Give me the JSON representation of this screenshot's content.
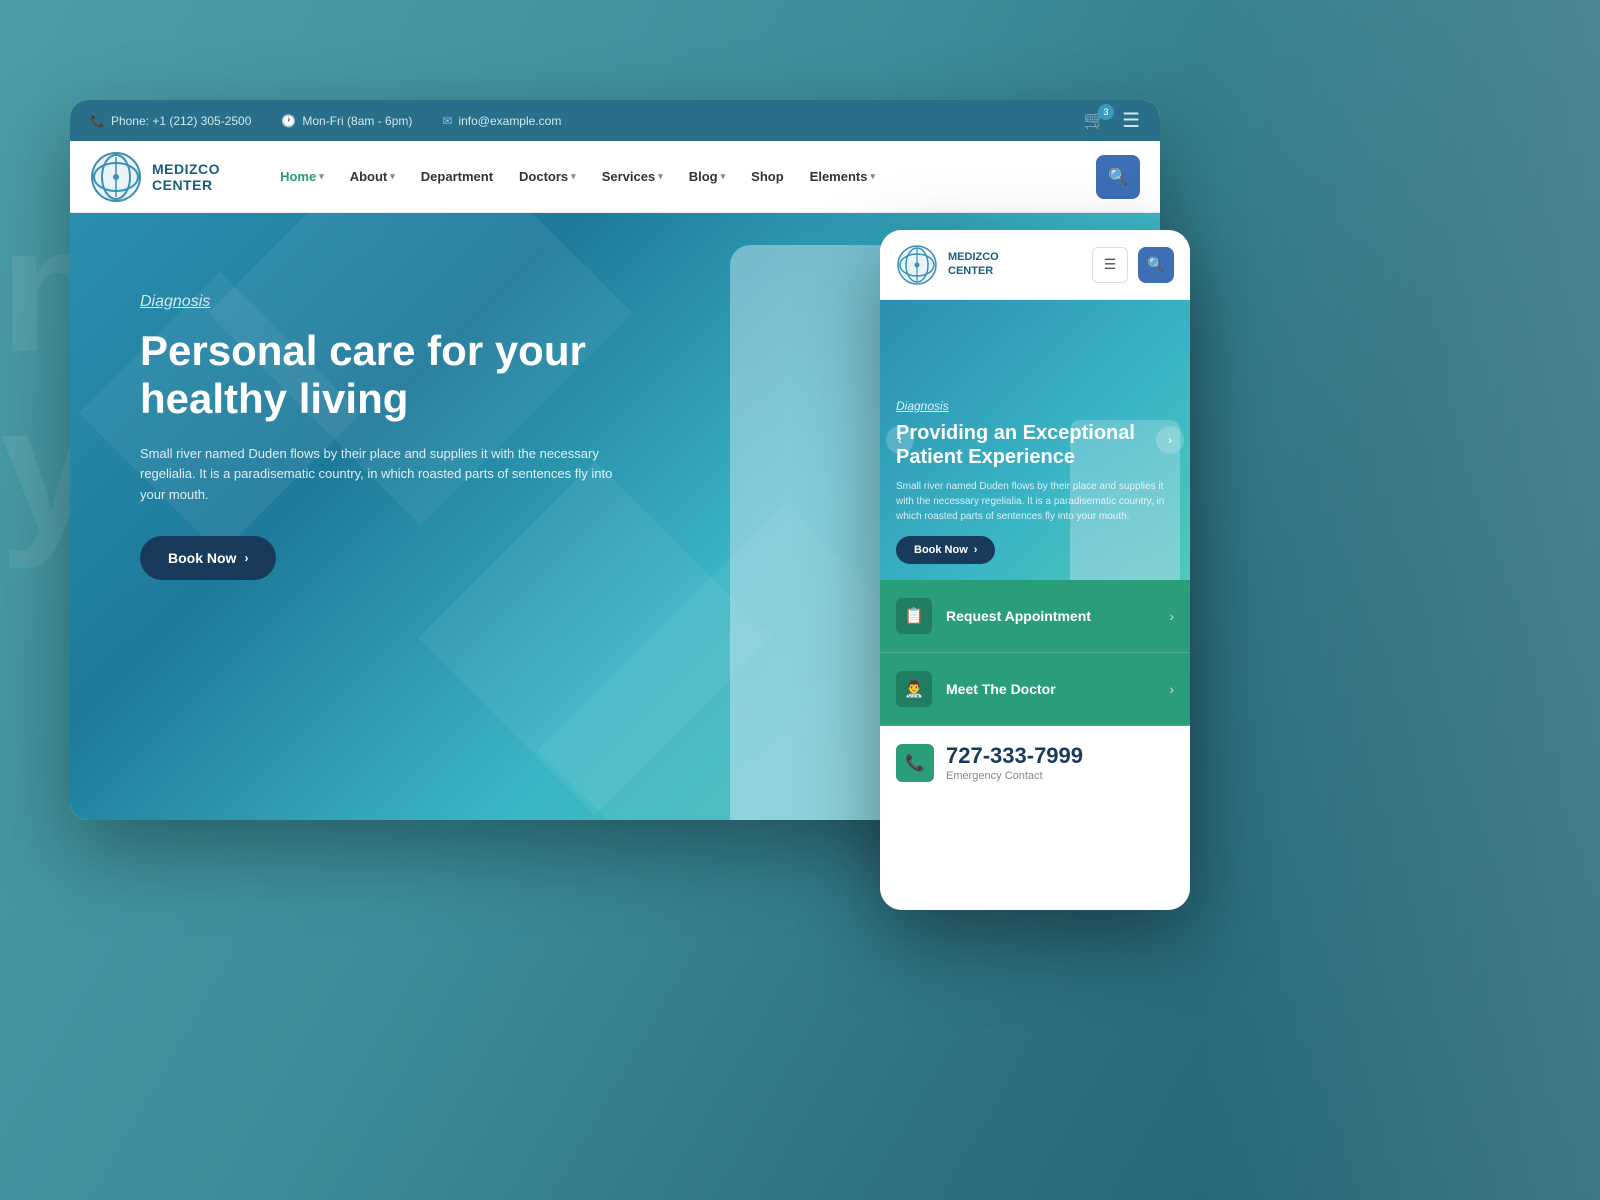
{
  "background": {
    "bg_text": "na\ny"
  },
  "desktop": {
    "topbar": {
      "phone_icon": "📞",
      "phone_label": "Phone: +1 (212) 305-2500",
      "clock_icon": "🕐",
      "hours_label": "Mon-Fri (8am - 6pm)",
      "email_icon": "✉",
      "email_label": "info@example.com",
      "cart_count": "3",
      "hamburger_icon": "☰"
    },
    "nav": {
      "logo_text_line1": "MEDIZCO",
      "logo_text_line2": "CENTER",
      "menu_items": [
        {
          "label": "Home",
          "has_arrow": true,
          "active": true
        },
        {
          "label": "About",
          "has_arrow": true,
          "active": false
        },
        {
          "label": "Department",
          "has_arrow": false,
          "active": false
        },
        {
          "label": "Doctors",
          "has_arrow": true,
          "active": false
        },
        {
          "label": "Services",
          "has_arrow": true,
          "active": false
        },
        {
          "label": "Blog",
          "has_arrow": true,
          "active": false
        },
        {
          "label": "Shop",
          "has_arrow": false,
          "active": false
        },
        {
          "label": "Elements",
          "has_arrow": true,
          "active": false
        }
      ],
      "search_icon": "🔍"
    },
    "hero": {
      "subtitle": "Diagnosis",
      "title_line1": "Personal care for your",
      "title_line2": "healthy living",
      "description": "Small river named Duden flows by their place and supplies it with the necessary regelialia. It is a paradisematic country, in which roasted parts of sentences fly into your mouth.",
      "book_btn": "Book Now",
      "book_arrow": "›"
    }
  },
  "mobile": {
    "header": {
      "logo_text_line1": "MEDIZCO",
      "logo_text_line2": "CENTER",
      "hamburger_icon": "☰",
      "search_icon": "🔍"
    },
    "hero": {
      "subtitle": "Diagnosis",
      "title_line1": "Providing an Exceptional",
      "title_line2": "Patient Experience",
      "description": "Small river named Duden flows by their place and supplies it with the necessary regelialia. It is a paradisematic country, in which roasted parts of sentences fly into your mouth.",
      "book_btn": "Book Now",
      "book_arrow": "›",
      "prev_icon": "‹",
      "next_icon": "›"
    },
    "list": {
      "items": [
        {
          "icon": "📋",
          "label": "Request Appointment",
          "arrow": "›"
        },
        {
          "icon": "👨‍⚕️",
          "label": "Meet The Doctor",
          "arrow": "›"
        }
      ]
    },
    "phone_cta": {
      "icon": "📞",
      "phone_number": "727-333-7999",
      "label": "Emergency Contact"
    }
  }
}
